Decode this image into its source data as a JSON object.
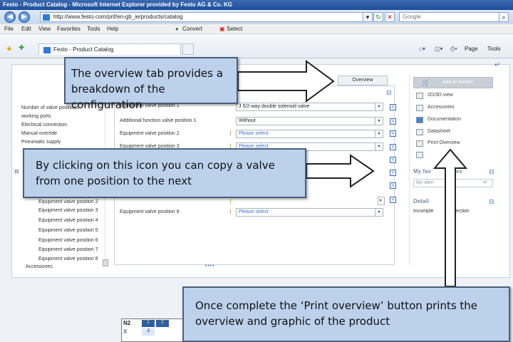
{
  "window": {
    "title": "Festo - Product Catalog - Microsoft Internet Explorer provided by Festo AG & Co. KG"
  },
  "browser": {
    "url": "http://www.festo.com/pnf/en-gb_ie/products/catalog",
    "search_placeholder": "Google",
    "menu": [
      "File",
      "Edit",
      "View",
      "Favorites",
      "Tools",
      "Help"
    ],
    "toolbar": {
      "convert": "Convert",
      "select": "Select"
    },
    "tab_title": "Festo - Product Catalog",
    "right_tools": {
      "page": "Page",
      "tools": "Tools"
    }
  },
  "left_panel": {
    "items": [
      "Number of valve positions",
      "working ports",
      "Electrical connection",
      "Manual override",
      "Pneumatic supply"
    ],
    "valve_items": [
      "Equipment valve position 2",
      "Equipment valve position 3",
      "Equipment valve position 4",
      "Equipment valve position 5",
      "Equipment valve position 6",
      "Equipment valve position 7",
      "Equipment valve position 8"
    ],
    "last_item": "Accessories"
  },
  "tabs": {
    "overview": "Overview"
  },
  "form": {
    "rows": [
      {
        "label": "Equipment valve position 1",
        "value": "J 5/2-way double solenoid valve",
        "placeholder": false
      },
      {
        "label": "Additional function valve position 1",
        "value": "Without",
        "placeholder": false
      },
      {
        "label": "Equipment valve position 2",
        "value": "Please select",
        "placeholder": true
      },
      {
        "label": "Equipment valve position 3",
        "value": "Please select",
        "placeholder": true
      },
      {
        "label": "Equipment valve position 8",
        "value": "Please select",
        "placeholder": true
      }
    ]
  },
  "right_panel": {
    "add_to_basket": "Add to basket",
    "actions": [
      "2D/3D view",
      "Accessories",
      "Documentation",
      "Datasheet",
      "Print Overview"
    ],
    "favourites_title": "My fav",
    "favourites_title_end": "es",
    "favourites_input": "My iden",
    "details_title": "Detail",
    "details_text_start": "Incomple",
    "details_text_end": "ection"
  },
  "grid": {
    "cell_name": "N2",
    "header": [
      "1",
      "2"
    ],
    "row_label": "X",
    "row_value": "J"
  },
  "callouts": {
    "overview": "The overview tab provides a breakdown of the configuration",
    "copy": "By clicking on this icon you can copy a valve from one position to the next",
    "print": "Once complete the ‘Print overview’ button prints the overview and graphic of the product"
  }
}
